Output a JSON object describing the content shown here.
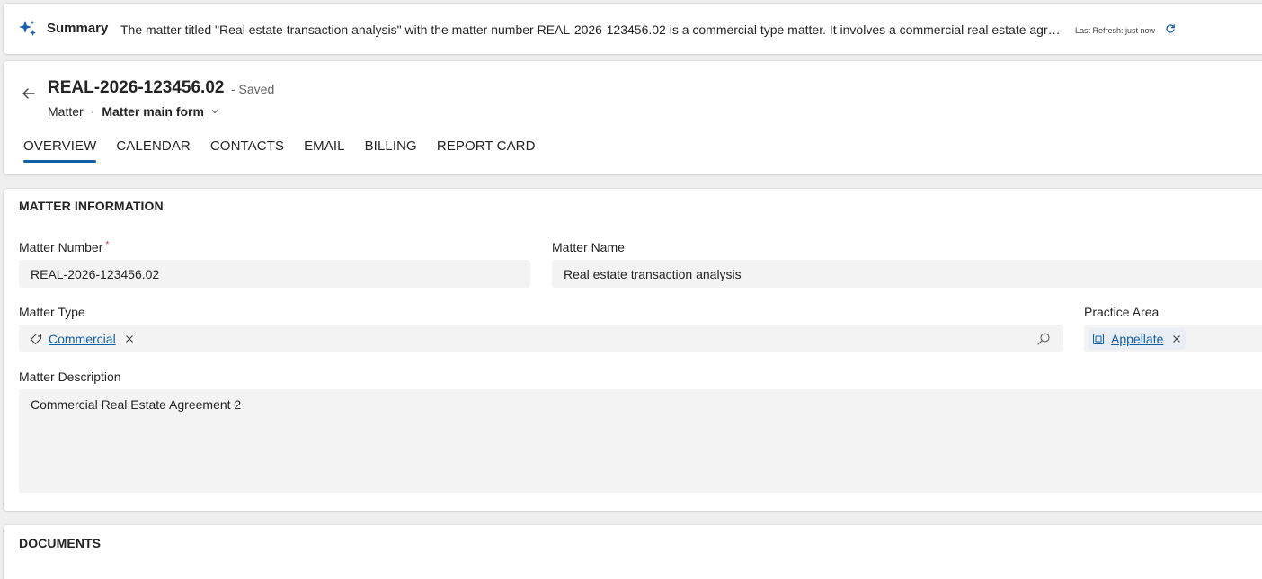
{
  "summary": {
    "title": "Summary",
    "text": "The matter titled \"Real estate transaction analysis\" with the matter number REAL-2026-123456.02 is a commercial type matter. It involves a commercial real estate agree...",
    "refresh_label": "Last Refresh: just now"
  },
  "header": {
    "record_title": "REAL-2026-123456.02",
    "save_status": "- Saved",
    "entity": "Matter",
    "separator": "·",
    "form_name": "Matter main form"
  },
  "tabs": [
    {
      "label": "OVERVIEW",
      "active": true
    },
    {
      "label": "CALENDAR",
      "active": false
    },
    {
      "label": "CONTACTS",
      "active": false
    },
    {
      "label": "EMAIL",
      "active": false
    },
    {
      "label": "BILLING",
      "active": false
    },
    {
      "label": "REPORT CARD",
      "active": false
    }
  ],
  "matter_info": {
    "section_title": "MATTER INFORMATION",
    "matter_number": {
      "label": "Matter Number",
      "required_marker": "*",
      "value": "REAL-2026-123456.02"
    },
    "matter_name": {
      "label": "Matter Name",
      "value": "Real estate transaction analysis"
    },
    "matter_type": {
      "label": "Matter Type",
      "value": "Commercial"
    },
    "practice_area": {
      "label": "Practice Area",
      "value": "Appellate"
    },
    "matter_description": {
      "label": "Matter Description",
      "value": "Commercial Real Estate Agreement 2"
    }
  },
  "documents": {
    "section_title": "DOCUMENTS"
  },
  "colors": {
    "accent": "#115ea3",
    "field_bg": "#f3f3f3",
    "page_bg": "#efefef",
    "required": "#c4314b"
  },
  "icons": {
    "summary": "sparkle-icon",
    "refresh": "refresh-icon",
    "back": "back-arrow-icon",
    "form_dropdown": "chevron-down-icon",
    "matter_type": "tag-icon",
    "practice_area": "practice-area-entity-icon",
    "remove": "close-icon",
    "lookup": "search-icon"
  }
}
